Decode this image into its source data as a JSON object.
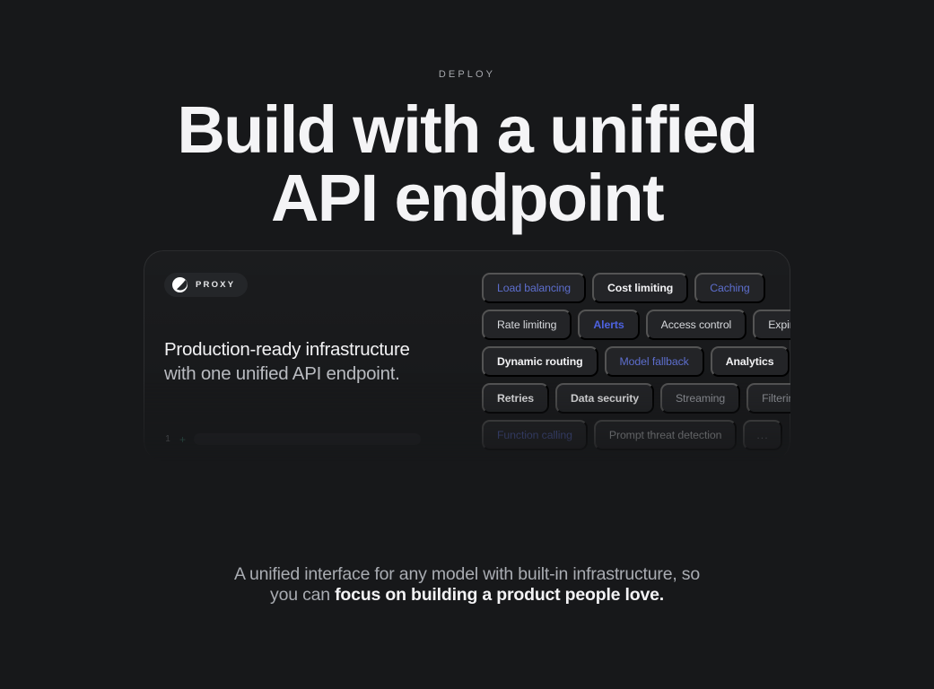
{
  "hero": {
    "eyebrow": "DEPLOY",
    "title_line1": "Build with a unified",
    "title_line2": "API endpoint"
  },
  "card": {
    "brand": {
      "icon": "proxy-droplet-logo",
      "name": "PROXY"
    },
    "headline_line1": "Production-ready infrastructure",
    "headline_line2": "with one unified API endpoint.",
    "slider": {
      "count": "1",
      "plus": "+",
      "track_value": 100
    },
    "tag_rows": [
      [
        {
          "label": "Load balancing",
          "style": "accent"
        },
        {
          "label": "Cost limiting",
          "style": "bold"
        },
        {
          "label": "Caching",
          "style": "accent"
        }
      ],
      [
        {
          "label": "Rate limiting",
          "style": "normal"
        },
        {
          "label": "Alerts",
          "style": "accent-bright"
        },
        {
          "label": "Access control",
          "style": "normal"
        },
        {
          "label": "Expiry",
          "style": "normal"
        }
      ],
      [
        {
          "label": "Dynamic routing",
          "style": "bold"
        },
        {
          "label": "Model fallback",
          "style": "accent"
        },
        {
          "label": "Analytics",
          "style": "bold"
        }
      ],
      [
        {
          "label": "Retries",
          "style": "bold"
        },
        {
          "label": "Data security",
          "style": "bold"
        },
        {
          "label": "Streaming",
          "style": "dim"
        },
        {
          "label": "Filtering",
          "style": "dim"
        }
      ],
      [
        {
          "label": "Function calling",
          "style": "accent"
        },
        {
          "label": "Prompt threat detection",
          "style": "normal"
        },
        {
          "label": "...",
          "style": "ellipsis"
        }
      ]
    ]
  },
  "footer": {
    "line1": "A unified interface for any model with built-in infrastructure, so",
    "line2_prefix": "you can ",
    "line2_strong": "focus on building a product people love."
  },
  "colors": {
    "background": "#17181a",
    "card_surface": "#18191b",
    "tag_surface": "#232427",
    "accent_blue": "#5d6ecd",
    "accent_blue_bright": "#4d62e0",
    "accent_green": "#3f8f79",
    "text_primary": "#f3f3f5",
    "text_secondary": "#a9acb2"
  }
}
